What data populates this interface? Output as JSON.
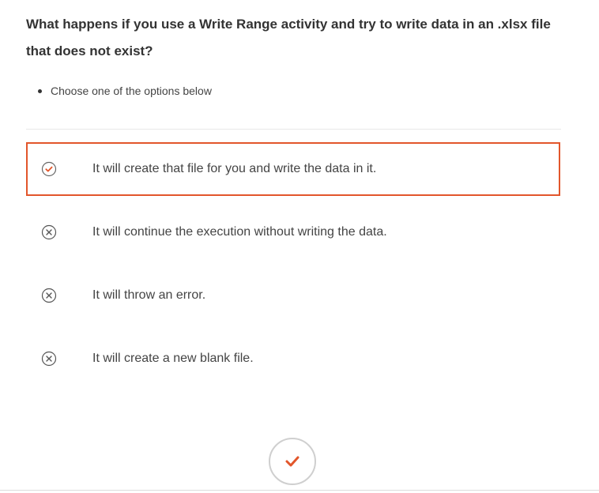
{
  "question": {
    "text": "What happens if you use a Write Range activity and try to write data in an .xlsx file that does not exist?"
  },
  "instructions": {
    "items": [
      "Choose one of the options below"
    ]
  },
  "options": [
    {
      "label": "It will create that file for you and write the data in it.",
      "selected": true,
      "icon": "check-circle-icon"
    },
    {
      "label": "It will continue the execution without writing the data.",
      "selected": false,
      "icon": "x-circle-icon"
    },
    {
      "label": "It will throw an error.",
      "selected": false,
      "icon": "x-circle-icon"
    },
    {
      "label": "It will create a new blank file.",
      "selected": false,
      "icon": "x-circle-icon"
    }
  ],
  "submit": {
    "icon": "checkmark-icon"
  },
  "colors": {
    "accent": "#e2562b",
    "text": "#333333",
    "icon_gray": "#555555",
    "border_gray": "#cfcfcf"
  }
}
